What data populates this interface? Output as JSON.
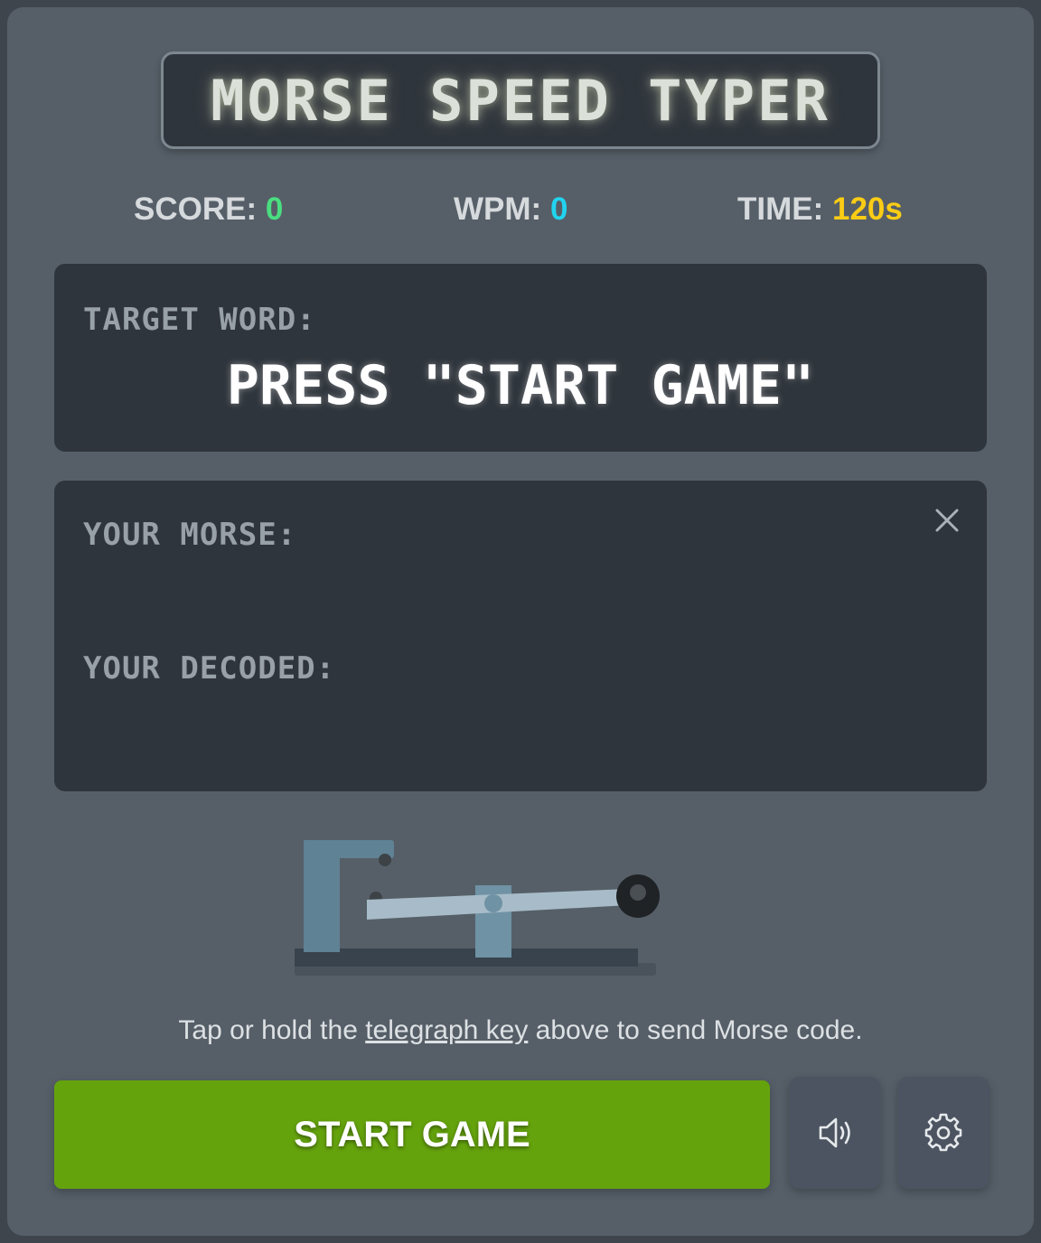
{
  "title": "MORSE SPEED TYPER",
  "stats": {
    "score_label": "SCORE:",
    "score_value": "0",
    "wpm_label": "WPM:",
    "wpm_value": "0",
    "time_label": "TIME:",
    "time_value": "120s"
  },
  "target": {
    "label": "TARGET WORD:",
    "word": "PRESS \"START GAME\""
  },
  "input": {
    "morse_label": "YOUR MORSE:",
    "morse_value": "",
    "decoded_label": "YOUR DECODED:",
    "decoded_value": ""
  },
  "instructions": {
    "before": "Tap or hold the ",
    "link": "telegraph key",
    "after": " above to send Morse code."
  },
  "controls": {
    "start_label": "START GAME",
    "sound_icon": "speaker-icon",
    "settings_icon": "gear-icon"
  },
  "colors": {
    "score": "#4ade80",
    "wpm": "#22d3ee",
    "time": "#facc15",
    "start_button": "#65a30d"
  }
}
